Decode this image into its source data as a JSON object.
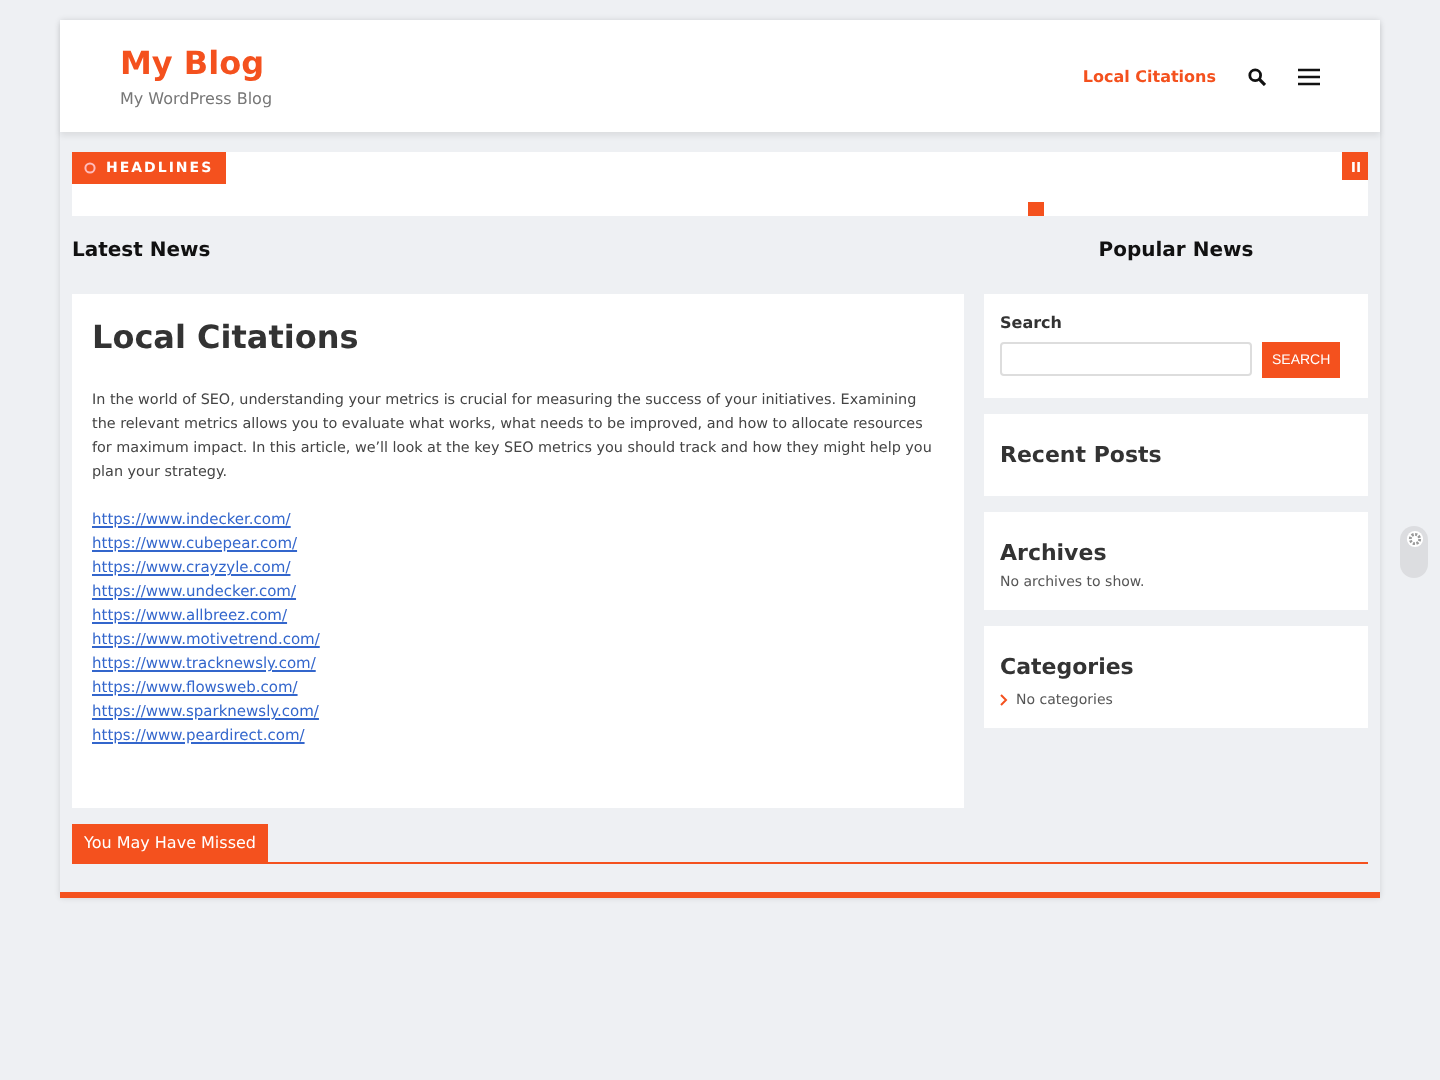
{
  "header": {
    "site_title": "My Blog",
    "tagline": "My WordPress Blog",
    "nav": [
      {
        "label": "Local Citations",
        "selected": true
      }
    ]
  },
  "ticker": {
    "label": "HEADLINES"
  },
  "latest_news": {
    "heading": "Latest News"
  },
  "popular_news": {
    "heading": "Popular News"
  },
  "post": {
    "title": "Local Citations",
    "body": "In the world of SEO, understanding your metrics is crucial for measuring the success of your initiatives. Examining the relevant metrics allows you to evaluate what works, what needs to be improved, and how to allocate resources for maximum impact. In this article, we’ll look at the key SEO metrics you should track and how they might help you plan your strategy.",
    "links": [
      "https://www.indecker.com/",
      "https://www.cubepear.com/",
      "https://www.crayzyle.com/",
      "https://www.undecker.com/",
      "https://www.allbreez.com/",
      "https://www.motivetrend.com/",
      "https://www.tracknewsly.com/",
      "https://www.flowsweb.com/",
      "https://www.sparknewsly.com/",
      "https://www.peardirect.com/"
    ]
  },
  "sidebar": {
    "search": {
      "label": "Search",
      "button": "SEARCH"
    },
    "widgets": [
      {
        "kind": "empty",
        "title": "Recent Posts"
      },
      {
        "kind": "text",
        "title": "Archives",
        "text": "No archives to show."
      },
      {
        "kind": "list",
        "title": "Categories",
        "items": [
          "No categories"
        ]
      }
    ]
  },
  "missed": {
    "heading": "You May Have Missed"
  }
}
